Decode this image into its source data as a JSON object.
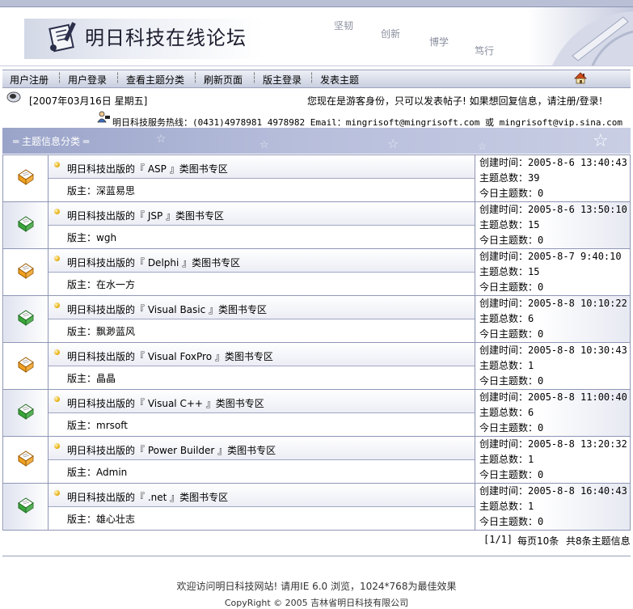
{
  "header": {
    "site_title": "明日科技在线论坛",
    "slogans": [
      "坚韧",
      "创新",
      "博学",
      "笃行"
    ]
  },
  "menu": {
    "items": [
      "用户注册",
      "用户登录",
      "查看主题分类",
      "刷新页面",
      "版主登录",
      "发表主题"
    ],
    "separator": "┆"
  },
  "info": {
    "date": "[2007年03月16日 星期五]",
    "guest_notice": "您现在是游客身份，只可以发表帖子! 如果想回复信息，请注册/登录!",
    "hotline_label": "明日科技服务热线：",
    "hotline_text": "(0431)4978981 4978982 Email：mingrisoft@mingrisoft.com 或 mingrisoft@vip.sina.com"
  },
  "section": {
    "title": "═ 主题信息分类 ═"
  },
  "labels": {
    "moderator": "版主：",
    "created": "创建时间：",
    "topic_total": "主题总数：",
    "today_topics": "今日主题数："
  },
  "categories": [
    {
      "title": "明日科技出版的『 ASP 』类图书专区",
      "moderator": "深蓝易思",
      "created": "2005-8-6 13:40:43",
      "total": "39",
      "today": "0",
      "icon": "open-folder-orange-icon"
    },
    {
      "title": "明日科技出版的『 JSP 』类图书专区",
      "moderator": "wgh",
      "created": "2005-8-6 13:50:10",
      "total": "15",
      "today": "0",
      "icon": "open-folder-green-icon"
    },
    {
      "title": "明日科技出版的『 Delphi 』类图书专区",
      "moderator": "在水一方",
      "created": "2005-8-7 9:40:10",
      "total": "15",
      "today": "0",
      "icon": "open-folder-orange-icon"
    },
    {
      "title": "明日科技出版的『 Visual Basic 』类图书专区",
      "moderator": "飘渺蓝风",
      "created": "2005-8-8 10:10:22",
      "total": "6",
      "today": "0",
      "icon": "open-folder-green-icon"
    },
    {
      "title": "明日科技出版的『 Visual FoxPro 』类图书专区",
      "moderator": "晶晶",
      "created": "2005-8-8 10:30:43",
      "total": "1",
      "today": "0",
      "icon": "open-folder-orange-icon"
    },
    {
      "title": "明日科技出版的『 Visual C++ 』类图书专区",
      "moderator": "mrsoft",
      "created": "2005-8-8 11:00:40",
      "total": "6",
      "today": "0",
      "icon": "open-folder-green-icon"
    },
    {
      "title": "明日科技出版的『 Power Builder 』类图书专区",
      "moderator": "Admin",
      "created": "2005-8-8 13:20:32",
      "total": "1",
      "today": "0",
      "icon": "open-folder-orange-icon"
    },
    {
      "title": "明日科技出版的『 .net 』类图书专区",
      "moderator": "雄心壮志",
      "created": "2005-8-8 16:40:43",
      "total": "1",
      "today": "0",
      "icon": "open-folder-green-icon"
    }
  ],
  "pager": {
    "current": "[1/1]",
    "per_page": "每页10条",
    "total": "共8条主题信息"
  },
  "footer": {
    "line1": "欢迎访问明日科技网站! 请用IE 6.0 浏览，1024*768为最佳效果",
    "line2": "CopyRight © 2005 吉林省明日科技有限公司"
  },
  "colors": {
    "menu_bar": "#c9cfe0",
    "section_header": "#9aa4c9",
    "border": "#8e96b5",
    "icon_orange": "#f0a020",
    "icon_green": "#3aa63a"
  }
}
